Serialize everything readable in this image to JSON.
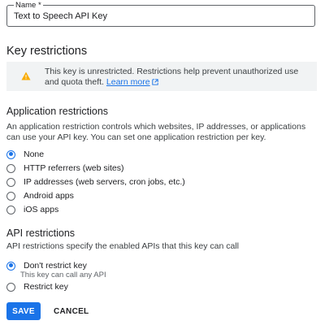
{
  "name_field": {
    "label": "Name *",
    "value": "Text to Speech API Key"
  },
  "key_restrictions": {
    "heading": "Key restrictions",
    "warning": {
      "icon": "warning-icon",
      "text": "This key is unrestricted. Restrictions help prevent unauthorized use and quota theft.",
      "link_text": "Learn more",
      "link_icon": "external-link-icon"
    }
  },
  "application_restrictions": {
    "heading": "Application restrictions",
    "description": "An application restriction controls which websites, IP addresses, or applications can use your API key. You can set one application restriction per key.",
    "options": [
      {
        "label": "None",
        "checked": true
      },
      {
        "label": "HTTP referrers (web sites)",
        "checked": false
      },
      {
        "label": "IP addresses (web servers, cron jobs, etc.)",
        "checked": false
      },
      {
        "label": "Android apps",
        "checked": false
      },
      {
        "label": "iOS apps",
        "checked": false
      }
    ]
  },
  "api_restrictions": {
    "heading": "API restrictions",
    "description": "API restrictions specify the enabled APIs that this key can call",
    "options": [
      {
        "label": "Don't restrict key",
        "sublabel": "This key can call any API",
        "checked": true
      },
      {
        "label": "Restrict key",
        "checked": false
      }
    ]
  },
  "actions": {
    "save_label": "SAVE",
    "cancel_label": "CANCEL"
  },
  "colors": {
    "accent": "#1a73e8",
    "warning": "#f9ab00"
  }
}
